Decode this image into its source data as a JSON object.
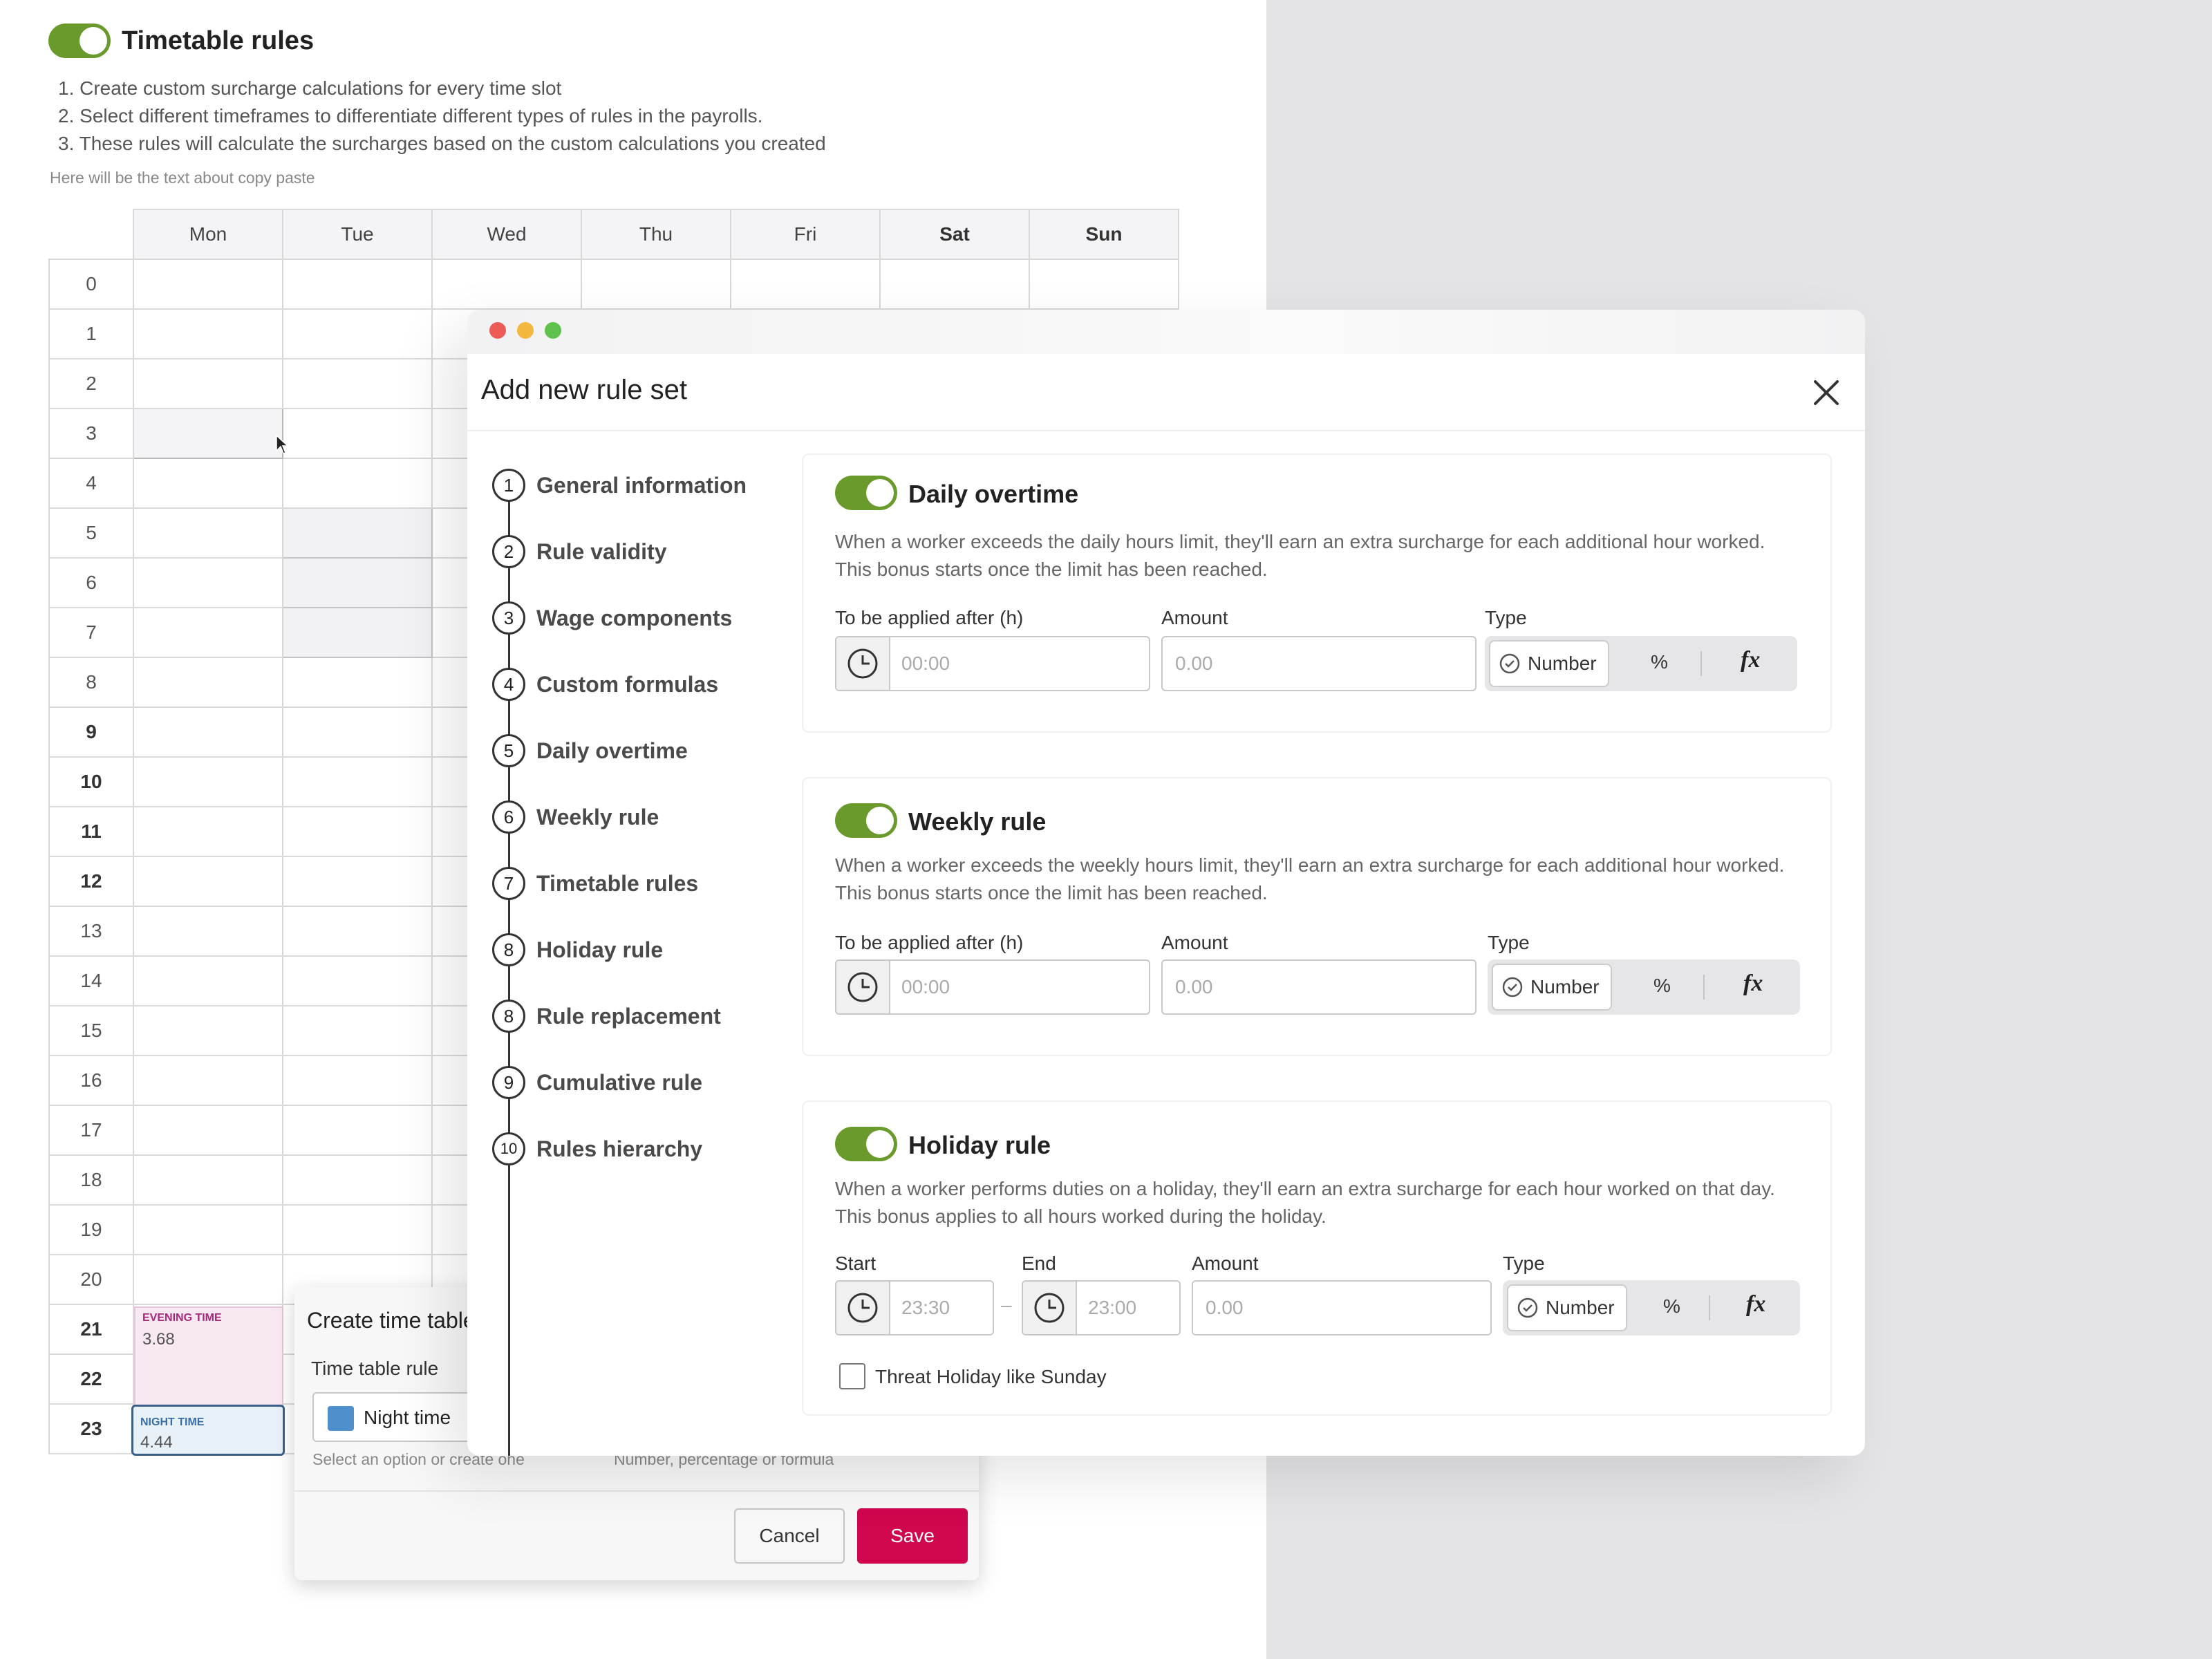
{
  "page": {
    "title": "Timetable rules",
    "toggle_on": true,
    "instructions": [
      "Create custom surcharge calculations for every time slot",
      "Select different timeframes to differentiate different types of rules in the payrolls.",
      "These rules will calculate the surcharges based on the custom calculations you created"
    ],
    "hint": "Here will be the text about copy paste"
  },
  "timetable": {
    "days": [
      "Mon",
      "Tue",
      "Wed",
      "Thu",
      "Fri",
      "Sat",
      "Sun"
    ],
    "hours": [
      "0",
      "1",
      "2",
      "3",
      "4",
      "5",
      "6",
      "7",
      "8",
      "9",
      "10",
      "11",
      "12",
      "13",
      "14",
      "15",
      "16",
      "17",
      "18",
      "19",
      "20",
      "21",
      "22",
      "23"
    ],
    "blocks": [
      {
        "label": "EVENING TIME",
        "value": "3.68"
      },
      {
        "label": "NIGHT TIME",
        "value": "4.44"
      }
    ]
  },
  "create_dialog": {
    "title": "Create time table",
    "field_label": "Time table rule",
    "selected_option": "Night time",
    "selected_color": "#4f8fcc",
    "helper_left": "Select an option or create one",
    "helper_right": "Number, percentage or formula",
    "cancel_label": "Cancel",
    "save_label": "Save"
  },
  "modal": {
    "title": "Add new rule set",
    "steps": [
      {
        "n": "1",
        "label": "General information"
      },
      {
        "n": "2",
        "label": "Rule validity"
      },
      {
        "n": "3",
        "label": "Wage components"
      },
      {
        "n": "4",
        "label": "Custom formulas"
      },
      {
        "n": "5",
        "label": "Daily overtime"
      },
      {
        "n": "6",
        "label": "Weekly rule"
      },
      {
        "n": "7",
        "label": "Timetable rules"
      },
      {
        "n": "8",
        "label": "Holiday rule"
      },
      {
        "n": "8",
        "label": "Rule replacement"
      },
      {
        "n": "9",
        "label": "Cumulative rule"
      },
      {
        "n": "10",
        "label": "Rules hierarchy"
      }
    ],
    "daily": {
      "title": "Daily overtime",
      "enabled": true,
      "desc1": "When a worker exceeds the daily hours limit, they'll earn an extra surcharge for each additional hour worked.",
      "desc2": "This bonus starts once the limit has been reached.",
      "after_label": "To be applied after (h)",
      "after_placeholder": "00:00",
      "amount_label": "Amount",
      "amount_placeholder": "0.00",
      "type_label": "Type",
      "type_number": "Number",
      "type_percent": "%",
      "type_formula": "fx"
    },
    "weekly": {
      "title": "Weekly rule",
      "enabled": true,
      "desc1": "When a worker exceeds the weekly hours limit, they'll earn an extra surcharge for each additional hour worked.",
      "desc2": "This bonus starts once the limit has been reached.",
      "after_label": "To be applied after (h)",
      "after_placeholder": "00:00",
      "amount_label": "Amount",
      "amount_placeholder": "0.00",
      "type_label": "Type",
      "type_number": "Number",
      "type_percent": "%",
      "type_formula": "fx"
    },
    "holiday": {
      "title": "Holiday rule",
      "enabled": true,
      "desc1": "When a worker performs duties on a holiday, they'll earn an extra surcharge for each hour worked on that day.",
      "desc2": "This bonus applies to all hours worked during the holiday.",
      "start_label": "Start",
      "start_placeholder": "23:30",
      "end_label": "End",
      "end_placeholder": "23:00",
      "dash": "–",
      "amount_label": "Amount",
      "amount_placeholder": "0.00",
      "type_label": "Type",
      "type_number": "Number",
      "type_percent": "%",
      "type_formula": "fx",
      "checkbox_label": "Threat Holiday like Sunday",
      "checkbox_checked": false
    }
  },
  "colors": {
    "toggle": "#6a9a2c",
    "save_button": "#d0064f",
    "evening": "#a7297a",
    "night": "#3a5f88"
  }
}
